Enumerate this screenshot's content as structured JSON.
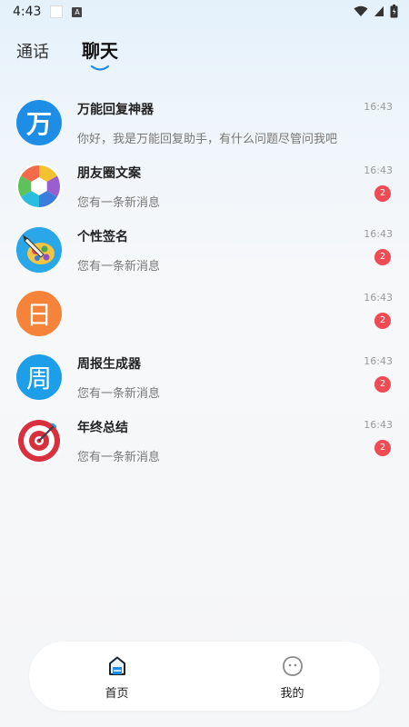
{
  "status_bar": {
    "time": "4:43",
    "notification_icon": "A"
  },
  "tabs": [
    {
      "label": "通话",
      "active": false
    },
    {
      "label": "聊天",
      "active": true
    }
  ],
  "chats": [
    {
      "name": "万能回复神器",
      "preview": "你好，我是万能回复助手，有什么问题尽管问我吧",
      "time": "16:43",
      "badge": "",
      "avatar_text": "万",
      "avatar_color": "#1e8de6",
      "avatar_icon": "wan-avatar-icon"
    },
    {
      "name": "朋友圈文案",
      "preview": "您有一条新消息",
      "time": "16:43",
      "badge": "2",
      "avatar_text": "",
      "avatar_color": "#ffffff",
      "avatar_icon": "aperture-icon"
    },
    {
      "name": "个性签名",
      "preview": "您有一条新消息",
      "time": "16:43",
      "badge": "2",
      "avatar_text": "",
      "avatar_color": "#2aa7e8",
      "avatar_icon": "pen-palette-icon"
    },
    {
      "name": "",
      "preview": "",
      "time": "16:43",
      "badge": "2",
      "avatar_text": "日",
      "avatar_color": "#f5833a",
      "avatar_icon": "calendar-day-icon"
    },
    {
      "name": "周报生成器",
      "preview": "您有一条新消息",
      "time": "16:43",
      "badge": "2",
      "avatar_text": "周",
      "avatar_color": "#1c9ee8",
      "avatar_icon": "week-icon"
    },
    {
      "name": "年终总结",
      "preview": "您有一条新消息",
      "time": "16:43",
      "badge": "2",
      "avatar_text": "",
      "avatar_color": "#ffffff",
      "avatar_icon": "target-icon"
    }
  ],
  "bottom_nav": [
    {
      "label": "首页",
      "icon": "home-icon",
      "active": true
    },
    {
      "label": "我的",
      "icon": "profile-icon",
      "active": false
    }
  ],
  "colors": {
    "accent": "#1e8de6",
    "badge": "#f04a54"
  }
}
